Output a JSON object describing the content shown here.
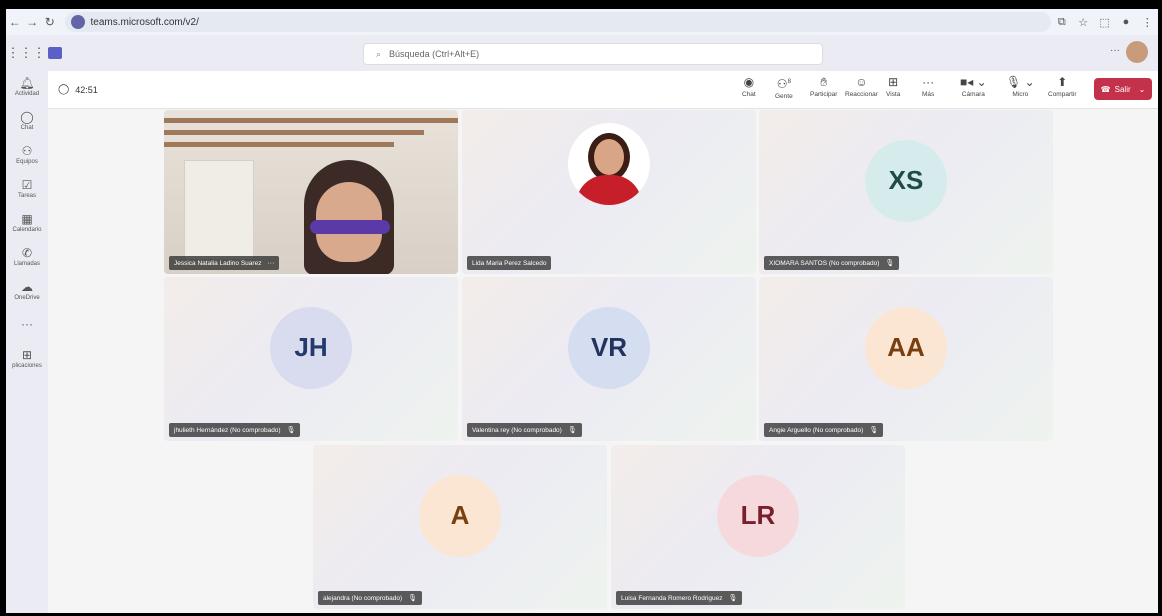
{
  "browser": {
    "url": "teams.microsoft.com/v2/"
  },
  "teams": {
    "search_placeholder": "Búsqueda (Ctrl+Alt+E)"
  },
  "rail": [
    {
      "label": "Actividad",
      "icon": "bell-icon"
    },
    {
      "label": "Chat",
      "icon": "chat-icon"
    },
    {
      "label": "Equipos",
      "icon": "teams-icon"
    },
    {
      "label": "Tareas",
      "icon": "tasks-icon"
    },
    {
      "label": "Calendario",
      "icon": "calendar-icon"
    },
    {
      "label": "Llamadas",
      "icon": "phone-icon"
    },
    {
      "label": "OneDrive",
      "icon": "cloud-icon"
    },
    {
      "label": "",
      "icon": "more-icon"
    },
    {
      "label": "plicaciones",
      "icon": "apps-add-icon"
    }
  ],
  "meeting": {
    "timer": "42:51",
    "toolbar": {
      "chat": "Chat",
      "people": "Gente",
      "people_count": "8",
      "raise": "Participar",
      "react": "Reaccionar",
      "view": "Vista",
      "more": "Más",
      "camera": "Cámara",
      "mic": "Micro",
      "share": "Compartir",
      "leave": "Salir"
    }
  },
  "participants": [
    {
      "name": "Jessica Natalia Ladino Suarez",
      "initials": "",
      "type": "video",
      "extra": "···"
    },
    {
      "name": "Lida Maria Perez Salcedo",
      "initials": "",
      "type": "photo"
    },
    {
      "name": "XIOMARA SANTOS (No comprobado)",
      "initials": "XS",
      "type": "initials",
      "avatar_bg": "#d6ecec",
      "avatar_fg": "#1e4a4a"
    },
    {
      "name": "jhulieth Hernández (No comprobado)",
      "initials": "JH",
      "type": "initials",
      "avatar_bg": "#d8dcee",
      "avatar_fg": "#243a6b"
    },
    {
      "name": "Valentina rey (No comprobado)",
      "initials": "VR",
      "type": "initials",
      "avatar_bg": "#d4def0",
      "avatar_fg": "#22345e"
    },
    {
      "name": "Angie Arguello (No comprobado)",
      "initials": "AA",
      "type": "initials",
      "avatar_bg": "#fbe6d3",
      "avatar_fg": "#7a3f10"
    },
    {
      "name": "alejandra (No comprobado)",
      "initials": "A",
      "type": "initials",
      "avatar_bg": "#fbe6d3",
      "avatar_fg": "#7a3f10"
    },
    {
      "name": "Luisa Fernanda Romero Rodriguez",
      "initials": "LR",
      "type": "initials",
      "avatar_bg": "#f6d9dd",
      "avatar_fg": "#7a1f2c"
    }
  ]
}
